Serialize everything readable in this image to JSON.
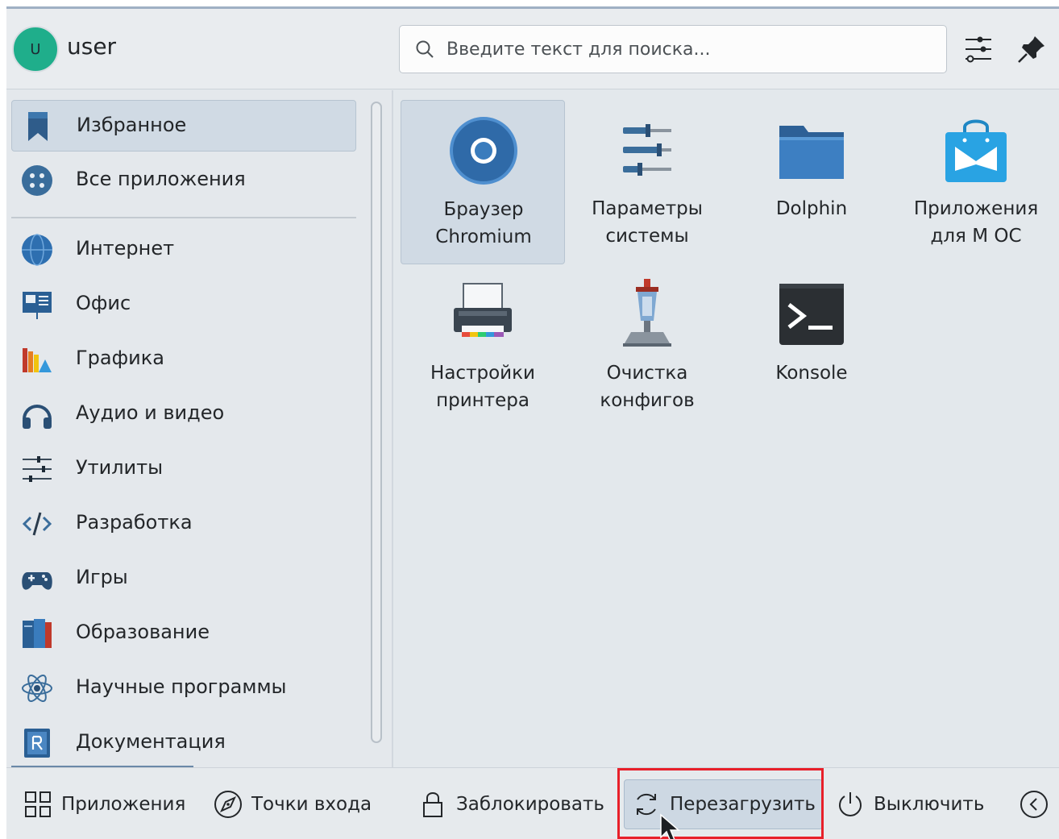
{
  "header": {
    "avatar_initial": "U",
    "username": "user",
    "search_placeholder": "Введите текст для поиска..."
  },
  "sidebar": {
    "categories": [
      {
        "label": "Избранное",
        "icon": "bookmark-icon",
        "active": true
      },
      {
        "label": "Все приложения",
        "icon": "grid-apps-icon"
      },
      {
        "label": "Интернет",
        "icon": "globe-icon"
      },
      {
        "label": "Офис",
        "icon": "presentation-icon"
      },
      {
        "label": "Графика",
        "icon": "graphics-icon"
      },
      {
        "label": "Аудио и видео",
        "icon": "headphones-icon"
      },
      {
        "label": "Утилиты",
        "icon": "sliders-icon"
      },
      {
        "label": "Разработка",
        "icon": "code-icon"
      },
      {
        "label": "Игры",
        "icon": "gamepad-icon"
      },
      {
        "label": "Образование",
        "icon": "books-icon"
      },
      {
        "label": "Научные программы",
        "icon": "atom-icon"
      },
      {
        "label": "Документация",
        "icon": "documentation-icon"
      }
    ]
  },
  "apps": [
    {
      "label": "Браузер Chromium",
      "icon": "chromium-icon",
      "active": true
    },
    {
      "label": "Параметры системы",
      "icon": "system-settings-icon"
    },
    {
      "label": "Dolphin",
      "icon": "folder-icon"
    },
    {
      "label": "Приложения для М ОС",
      "icon": "app-store-icon"
    },
    {
      "label": "Настройки принтера",
      "icon": "printer-icon"
    },
    {
      "label": "Очистка конфигов",
      "icon": "cleaner-icon"
    },
    {
      "label": "Konsole",
      "icon": "terminal-icon"
    }
  ],
  "footer": {
    "applications_label": "Приложения",
    "places_label": "Точки входа",
    "lock_label": "Заблокировать",
    "reboot_label": "Перезагрузить",
    "shutdown_label": "Выключить"
  },
  "colors": {
    "accent_highlight": "#e8202a",
    "selection": "#d0dae4",
    "avatar": "#1fae8b"
  }
}
